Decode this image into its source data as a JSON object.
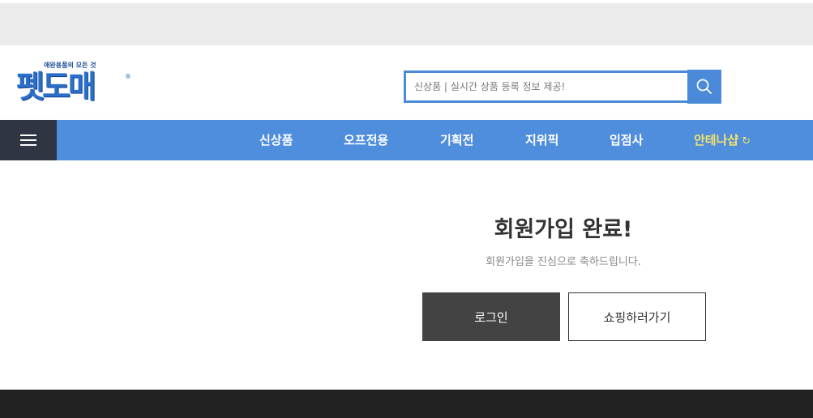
{
  "header": {
    "logo_tagline": "애완용품의 모든 것",
    "logo_text": "펫도매",
    "logo_reg": "®",
    "search": {
      "placeholder": "신상품 | 실시간 상품 등록 정보 제공!"
    }
  },
  "nav": {
    "items": [
      {
        "label": "신상품"
      },
      {
        "label": "오프전용"
      },
      {
        "label": "기획전"
      },
      {
        "label": "지위픽"
      },
      {
        "label": "입점사"
      },
      {
        "label": "안테나샵"
      }
    ],
    "highlight_color": "#f3e26a",
    "bar_color": "#4f8ddd"
  },
  "main": {
    "title": "회원가입 완료!",
    "subtitle": "회원가입을 진심으로 축하드립니다.",
    "login_label": "로그인",
    "shop_label": "쇼핑하러가기"
  }
}
